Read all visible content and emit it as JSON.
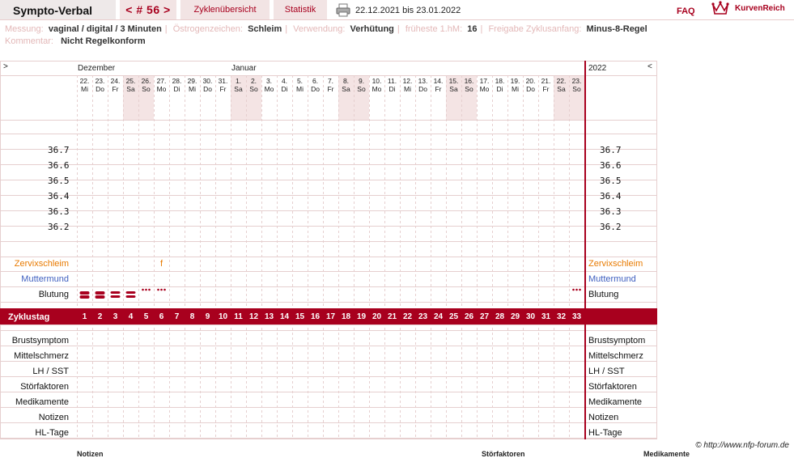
{
  "header": {
    "brand": "Sympto-Verbal",
    "cycle": "< # 56 >",
    "tab_cycles": "Zyklenübersicht",
    "tab_stats": "Statistik",
    "date_range": "22.12.2021 bis 23.01.2022",
    "faq": "FAQ",
    "logo_text": "KurvenReich"
  },
  "info_line1": [
    {
      "label": "Messung:",
      "value": "vaginal / digital / 3 Minuten"
    },
    {
      "label": "Östrogenzeichen:",
      "value": "Schleim"
    },
    {
      "label": "Verwendung:",
      "value": "Verhütung"
    },
    {
      "label": "früheste 1.hM:",
      "value": "16"
    },
    {
      "label": "Freigabe Zyklusanfang:",
      "value": "Minus-8-Regel"
    }
  ],
  "info_line2": {
    "label": "Kommentar:",
    "value": "Nicht Regelkonform"
  },
  "chart": {
    "left_arrow": ">",
    "right_arrow": "<",
    "month_1": "Dezember",
    "month_2": "Januar",
    "year": "2022",
    "days": [
      {
        "d": "22.",
        "w": "Mi"
      },
      {
        "d": "23.",
        "w": "Do"
      },
      {
        "d": "24.",
        "w": "Fr"
      },
      {
        "d": "25.",
        "w": "Sa"
      },
      {
        "d": "26.",
        "w": "So"
      },
      {
        "d": "27.",
        "w": "Mo"
      },
      {
        "d": "28.",
        "w": "Di"
      },
      {
        "d": "29.",
        "w": "Mi"
      },
      {
        "d": "30.",
        "w": "Do"
      },
      {
        "d": "31.",
        "w": "Fr"
      },
      {
        "d": "1.",
        "w": "Sa"
      },
      {
        "d": "2.",
        "w": "So"
      },
      {
        "d": "3.",
        "w": "Mo"
      },
      {
        "d": "4.",
        "w": "Di"
      },
      {
        "d": "5.",
        "w": "Mi"
      },
      {
        "d": "6.",
        "w": "Do"
      },
      {
        "d": "7.",
        "w": "Fr"
      },
      {
        "d": "8.",
        "w": "Sa"
      },
      {
        "d": "9.",
        "w": "So"
      },
      {
        "d": "10.",
        "w": "Mo"
      },
      {
        "d": "11.",
        "w": "Di"
      },
      {
        "d": "12.",
        "w": "Mi"
      },
      {
        "d": "13.",
        "w": "Do"
      },
      {
        "d": "14.",
        "w": "Fr"
      },
      {
        "d": "15.",
        "w": "Sa"
      },
      {
        "d": "16.",
        "w": "So"
      },
      {
        "d": "17.",
        "w": "Mo"
      },
      {
        "d": "18.",
        "w": "Di"
      },
      {
        "d": "19.",
        "w": "Mi"
      },
      {
        "d": "20.",
        "w": "Do"
      },
      {
        "d": "21.",
        "w": "Fr"
      },
      {
        "d": "22.",
        "w": "Sa"
      },
      {
        "d": "23.",
        "w": "So"
      }
    ],
    "weekend_days": [
      4,
      5,
      11,
      12,
      18,
      19,
      25,
      26,
      32,
      33
    ],
    "temps": [
      "36.7",
      "36.6",
      "36.5",
      "36.4",
      "36.3",
      "36.2"
    ],
    "rows": {
      "zervix": "Zervixschleim",
      "muttermund": "Muttermund",
      "blutung": "Blutung",
      "zyklustag": "Zyklustag",
      "brust": "Brustsymptom",
      "mittel": "Mittelschmerz",
      "lh": "LH / SST",
      "stoer": "Störfaktoren",
      "medi": "Medikamente",
      "notizen": "Notizen",
      "hl": "HL-Tage"
    },
    "zervix_mark": {
      "day": 6,
      "symbol": "f"
    },
    "bleeding": [
      {
        "day": 1,
        "type": "heavy"
      },
      {
        "day": 2,
        "type": "heavy"
      },
      {
        "day": 3,
        "type": "medium"
      },
      {
        "day": 4,
        "type": "medium"
      },
      {
        "day": 5,
        "type": "spot"
      },
      {
        "day": 6,
        "type": "spot"
      },
      {
        "day": 33,
        "type": "spot"
      }
    ],
    "colors": {
      "accent": "#a8001e",
      "weekend": "#f4e4e4",
      "grid": "#e6cfcf",
      "zervix": "#e87a00",
      "muttermund": "#4060c0"
    }
  },
  "footer": "© http://www.nfp-forum.de",
  "bottom": {
    "notizen": "Notizen",
    "stoer": "Störfaktoren",
    "medi": "Medikamente"
  }
}
